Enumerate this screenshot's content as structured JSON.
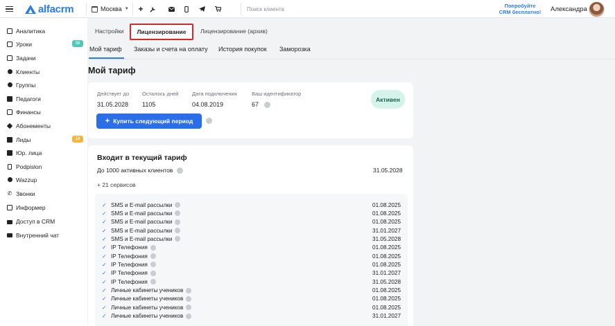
{
  "header": {
    "logo_text": "alfacrm",
    "city": "Москва",
    "search_placeholder": "Поиск клиента",
    "promo_line1": "Попробуйте",
    "promo_line2": "CRM бесплатно!",
    "user_name": "Александра",
    "tools": [
      "+",
      "wrench-icon",
      "mail-icon",
      "phone-icon",
      "telegram-icon",
      "cart-icon"
    ]
  },
  "sidebar": {
    "items": [
      {
        "label": "Аналитика",
        "icon": "analytics-icon"
      },
      {
        "label": "Уроки",
        "icon": "calendar-icon",
        "badge": "38"
      },
      {
        "label": "Задачи",
        "icon": "tasks-icon"
      },
      {
        "label": "Клиенты",
        "icon": "user-icon"
      },
      {
        "label": "Группы",
        "icon": "group-icon"
      },
      {
        "label": "Педагоги",
        "icon": "teacher-icon"
      },
      {
        "label": "Финансы",
        "icon": "finance-icon"
      },
      {
        "label": "Абонементы",
        "icon": "tag-icon"
      },
      {
        "label": "Лиды",
        "icon": "funnel-icon",
        "badge": "18"
      },
      {
        "label": "Юр. лица",
        "icon": "building-icon"
      },
      {
        "label": "Podpislon",
        "icon": "document-icon"
      },
      {
        "label": "Wazzup",
        "icon": "chat-icon"
      },
      {
        "label": "Звонки",
        "icon": "call-icon"
      },
      {
        "label": "Информер",
        "icon": "informer-icon"
      },
      {
        "label": "Доступ в CRM",
        "icon": "lock-icon"
      },
      {
        "label": "Внутренний чат",
        "icon": "message-icon"
      }
    ]
  },
  "tabs_top": {
    "settings": "Настройки",
    "licensing": "Лицензирование",
    "licensing_archive": "Лицензирование (архив)"
  },
  "tabs_sub": {
    "my_plan": "Мой тариф",
    "orders": "Заказы и счета на оплату",
    "history": "История покупок",
    "freeze": "Заморозка"
  },
  "page_title": "Мой тариф",
  "plan": {
    "valid_until_label": "Действует до",
    "valid_until": "31.05.2028",
    "days_left_label": "Осталось дней",
    "days_left": "1105",
    "connected_label": "Дата подключения",
    "connected": "04.08.2019",
    "id_label": "Ваш идентификатор",
    "id": "67",
    "status": "Активен",
    "buy_button": "Купить следующий период"
  },
  "included": {
    "title": "Входит в текущий тариф",
    "clients_text": "До 1000 активных клиентов",
    "clients_date": "31.05.2028",
    "services_count": "+ 21 сервисов",
    "services": [
      {
        "name": "SMS и E-mail рассылки",
        "date": "01.08.2025"
      },
      {
        "name": "SMS и E-mail рассылки",
        "date": "01.08.2025"
      },
      {
        "name": "SMS и E-mail рассылки",
        "date": "01.08.2025"
      },
      {
        "name": "SMS и E-mail рассылки",
        "date": "31.01.2027"
      },
      {
        "name": "SMS и E-mail рассылки",
        "date": "31.05.2028"
      },
      {
        "name": "IP Телефония",
        "date": "01.08.2025"
      },
      {
        "name": "IP Телефония",
        "date": "01.08.2025"
      },
      {
        "name": "IP Телефония",
        "date": "01.08.2025"
      },
      {
        "name": "IP Телефония",
        "date": "31.01.2027"
      },
      {
        "name": "IP Телефония",
        "date": "31.05.2028"
      },
      {
        "name": "Личные кабинеты учеников",
        "date": "01.08.2025"
      },
      {
        "name": "Личные кабинеты учеников",
        "date": "01.08.2025"
      },
      {
        "name": "Личные кабинеты учеников",
        "date": "01.08.2025"
      },
      {
        "name": "Личные кабинеты учеников",
        "date": "31.01.2027"
      }
    ]
  }
}
